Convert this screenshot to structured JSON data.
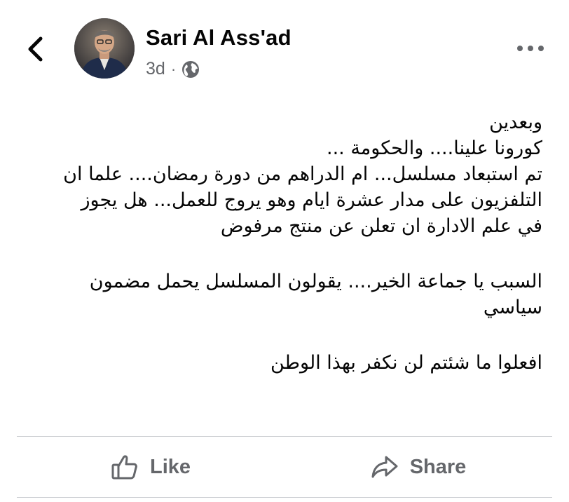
{
  "header": {
    "back_icon": "chevron-left-icon",
    "author_name": "Sari Al Ass'ad",
    "timestamp": "3d",
    "separator": "·",
    "audience_icon": "globe-icon",
    "more_icon": "more-horizontal-icon"
  },
  "post": {
    "lines": [
      "وبعدين",
      "كورونا علينا.... والحكومة ...",
      "تم استبعاد مسلسل... ام الدراهم من دورة رمضان.... علما ان",
      "التلفزيون على مدار عشرة ايام وهو يروج للعمل... هل يجوز",
      "في علم الادارة ان تعلن عن منتج مرفوض",
      "السبب يا جماعة الخير....  يقولون المسلسل يحمل مضمون",
      "سياسي",
      "افعلوا ما شئتم لن نكفر بهذا الوطن"
    ]
  },
  "actions": {
    "like_label": "Like",
    "like_icon": "thumbs-up-icon",
    "share_label": "Share",
    "share_icon": "share-arrow-icon"
  },
  "colors": {
    "text": "#050505",
    "secondary": "#65676b",
    "divider": "#ced0d4"
  }
}
